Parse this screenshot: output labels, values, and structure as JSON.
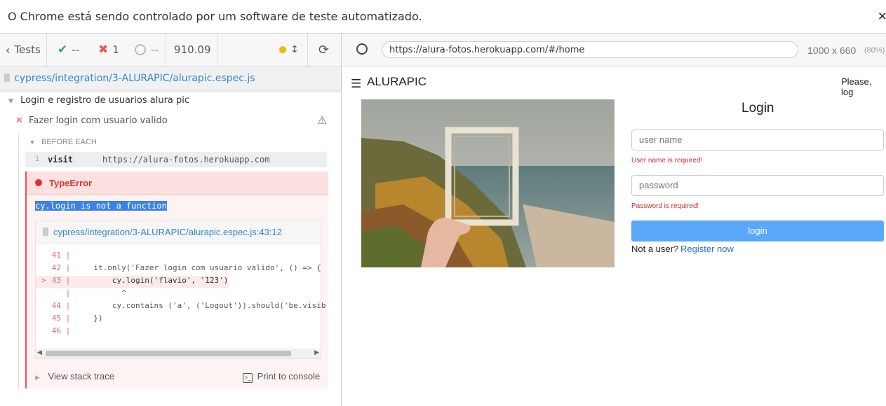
{
  "infobar": {
    "message": "O Chrome está sendo controlado por um software de teste automatizado.",
    "close": "✕"
  },
  "runner": {
    "tests_label": "Tests",
    "passed": "--",
    "failed": "1",
    "pending": "--",
    "duration": "910.09",
    "spec_path": "cypress/integration/3-ALURAPIC/alurapic.espec.js",
    "suite_title": "Login e registro de usuarios alura pic",
    "test_title": "Fazer login com usuario valido",
    "hook_label": "BEFORE EACH",
    "command": {
      "number": "1",
      "name": "visit",
      "message": "https://alura-fotos.herokuapp.com"
    },
    "error": {
      "type": "TypeError",
      "message": "cy.login is not a function",
      "file_link": "cypress/integration/3-ALURAPIC/alurapic.espec.js:43:12",
      "code_lines": [
        {
          "marker": "",
          "num": "41",
          "code": ""
        },
        {
          "marker": "",
          "num": "42",
          "code": "    it.only('Fazer login com usuario valido', () => {"
        },
        {
          "marker": ">",
          "num": "43",
          "code": "        cy.login('flavio', '123')"
        },
        {
          "marker": "",
          "num": "",
          "code": "          ^"
        },
        {
          "marker": "",
          "num": "44",
          "code": "        cy.contains ('a', ('Logout')).should('be.visib"
        },
        {
          "marker": "",
          "num": "45",
          "code": "    })"
        },
        {
          "marker": "",
          "num": "46",
          "code": ""
        }
      ],
      "stack_label": "View stack trace",
      "print_label": "Print to console"
    }
  },
  "browser": {
    "url": "https://alura-fotos.herokuapp.com/#/home",
    "viewport_size": "1000 x 660",
    "zoom": "(80%)"
  },
  "app": {
    "brand": "ALURAPIC",
    "greeting": "Please, log",
    "login_title": "Login",
    "username_placeholder": "user name",
    "username_error": "User name is required!",
    "password_placeholder": "password",
    "password_error": "Password is required!",
    "login_button": "login",
    "not_user": "Not a user?",
    "register_link": "Register now"
  },
  "colors": {
    "accent": "#3386d3",
    "error": "#e55",
    "button": "#5aa8f8",
    "pending_dot": "#f4b400"
  }
}
